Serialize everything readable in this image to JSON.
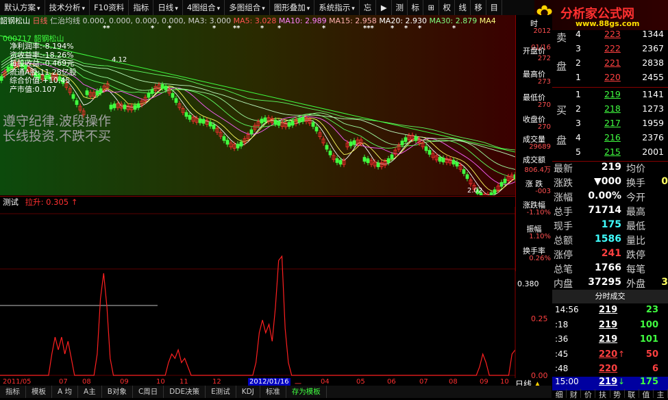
{
  "toolbar": [
    {
      "label": "默认方案",
      "arrow": "▾"
    },
    {
      "label": "技术分析",
      "arrow": "▾"
    },
    {
      "label": "F10资料",
      "arrow": ""
    },
    {
      "label": "指标",
      "arrow": ""
    },
    {
      "label": "日线",
      "arrow": "▾"
    },
    {
      "label": "4图组合",
      "arrow": "▾"
    },
    {
      "label": "多图组合",
      "arrow": "▾"
    },
    {
      "label": "图形叠加",
      "arrow": "▾"
    },
    {
      "label": "系统指示",
      "arrow": "▾"
    },
    {
      "label": "忘",
      "arrow": ""
    }
  ],
  "toolbar_icons": [
    "▶",
    "测",
    "标",
    "⊞",
    "权",
    "线",
    "移",
    "目"
  ],
  "logo": {
    "text": "分析家公式网",
    "url": "www.88gs.com"
  },
  "info_bar": {
    "name": "韶钢松山",
    "period": "日线",
    "ma_label": "仁治均线 0.000, 0.000, 0.000, 0.000,",
    "ma3": "MA3: 3.000",
    "ma5": "MA5: 3.028",
    "ma10": "MA10: 2.989",
    "ma15": "MA15: 2.958",
    "ma20": "MA20: 2.930",
    "ma30": "MA30: 2.879",
    "ma40": "MA4"
  },
  "stock_code": "000717 韶钢松山",
  "fundamentals": [
    "净利润率:-8.194%",
    "资收益率:-18.26%",
    "每股收益:-0.469元",
    "流通A股:11.28亿股",
    "综合价值:+10.45",
    "产市值:0.107"
  ],
  "watermark": [
    "遵守纪律.波段操作",
    "长线投资.不跌不买"
  ],
  "price_labels": {
    "high": "4.12",
    "low": "2.02"
  },
  "sub_chart": {
    "name": "测试",
    "indicator": "拉升: 0.305",
    "arrow": "↑",
    "yaxis": [
      "0.380",
      "0.25",
      "0.00"
    ]
  },
  "xaxis": [
    "2011/05",
    "07",
    "08",
    "09",
    "10",
    "11",
    "12",
    "2012/01/16",
    "一",
    "04",
    "05",
    "06",
    "07",
    "08",
    "09",
    "10"
  ],
  "bottom_tabs": [
    "指标",
    "模板",
    "A 均",
    "A主",
    "B对象",
    "C周日",
    "DDE决策",
    "E测试",
    "KDJ",
    "标准",
    "存为模板"
  ],
  "period_switch": "日线",
  "sidebar": [
    {
      "label": "时",
      "value": "2012"
    },
    {
      "label": "",
      "value": "01/16"
    },
    {
      "label": "开盘价",
      "value": "272"
    },
    {
      "label": "最高价",
      "value": "273"
    },
    {
      "label": "最低价",
      "value": "270"
    },
    {
      "label": "收盘价",
      "value": "270"
    },
    {
      "label": "成交量",
      "value": "29689"
    },
    {
      "label": "成交额",
      "value": "806.4万"
    },
    {
      "label": "涨 跌",
      "value": "-003"
    },
    {
      "label": "涨跌幅",
      "value": "-1.10%"
    },
    {
      "label": "振幅",
      "value": "1.10%"
    },
    {
      "label": "换手率",
      "value": "0.26%"
    }
  ],
  "orderbook": {
    "sell_label": [
      "卖",
      "盘"
    ],
    "buy_label": [
      "买",
      "盘"
    ],
    "sell": [
      {
        "level": "4",
        "price": "223",
        "vol": "1344"
      },
      {
        "level": "3",
        "price": "222",
        "vol": "2367"
      },
      {
        "level": "2",
        "price": "221",
        "vol": "2838"
      },
      {
        "level": "1",
        "price": "220",
        "vol": "2455"
      }
    ],
    "buy": [
      {
        "level": "1",
        "price": "219",
        "vol": "1141"
      },
      {
        "level": "2",
        "price": "218",
        "vol": "1273"
      },
      {
        "level": "3",
        "price": "217",
        "vol": "1959"
      },
      {
        "level": "4",
        "price": "216",
        "vol": "2376"
      },
      {
        "level": "5",
        "price": "215",
        "vol": "2001"
      }
    ]
  },
  "quote": [
    {
      "k1": "最新",
      "v1": "219",
      "k2": "均价",
      "v2": ""
    },
    {
      "k1": "涨跌",
      "v1": "▼000",
      "k2": "换手",
      "v2": "0"
    },
    {
      "k1": "涨幅",
      "v1": "0.00%",
      "k2": "今开",
      "v2": ""
    },
    {
      "k1": "总手",
      "v1": "71714",
      "k2": "最高",
      "v2": ""
    },
    {
      "k1": "现手",
      "v1": "175",
      "k2": "最低",
      "v2": ""
    },
    {
      "k1": "总额",
      "v1": "1586",
      "k2": "量比",
      "v2": ""
    },
    {
      "k1": "涨停",
      "v1": "241",
      "k2": "跌停",
      "v2": ""
    },
    {
      "k1": "总笔",
      "v1": "1766",
      "k2": "每笔",
      "v2": ""
    },
    {
      "k1": "内盘",
      "v1": "37295",
      "k2": "外盘",
      "v2": "3"
    }
  ],
  "ticks_header": "分时成交",
  "ticks": [
    {
      "time": "14:56",
      "price": "219",
      "arrow": "",
      "vol": "23"
    },
    {
      "time": ":18",
      "price": "219",
      "arrow": "",
      "vol": "100"
    },
    {
      "time": ":36",
      "price": "219",
      "arrow": "",
      "vol": "101"
    },
    {
      "time": ":45",
      "price": "220",
      "arrow": "↑",
      "vol": "50"
    },
    {
      "time": ":48",
      "price": "220",
      "arrow": "",
      "vol": "6"
    },
    {
      "time": "15:00",
      "price": "219",
      "arrow": "↓",
      "vol": "175"
    }
  ],
  "right_tabs": [
    "细",
    "财",
    "价",
    "扶",
    "势",
    "联",
    "值",
    "主"
  ],
  "chart_data": {
    "type": "line",
    "title": "测试 拉升",
    "x_range": [
      0,
      160
    ],
    "ylim": [
      0,
      0.38
    ],
    "series": [
      {
        "values": [
          0.0,
          0.0,
          0.0,
          0.0,
          0.0,
          0.0,
          0.0,
          0.0,
          0.0,
          0.0,
          0.0,
          0.0,
          0.0,
          0.0,
          0.0,
          0.0,
          0.05,
          0.09,
          0.06,
          0.09,
          0.05,
          0.08,
          0.04,
          0.0,
          0.0,
          0.0,
          0.0,
          0.0,
          0.0,
          0.0,
          0.05,
          0.18,
          0.24,
          0.16,
          0.04,
          0.0,
          0.0,
          0.0,
          0.0,
          0.0,
          0.0,
          0.0,
          0.0,
          0.0,
          0.0,
          0.0,
          0.0,
          0.0,
          0.0,
          0.0,
          0.0,
          0.0,
          0.03,
          0.05,
          0.04,
          0.06,
          0.03,
          0.04,
          0.02,
          0.0,
          0.0,
          0.0,
          0.0,
          0.0,
          0.0,
          0.0,
          0.0,
          0.0,
          0.0,
          0.0,
          0.0,
          0.0,
          0.0,
          0.0,
          0.0,
          0.0,
          0.0,
          0.0,
          0.0,
          0.03,
          0.1,
          0.13,
          0.1,
          0.12,
          0.08,
          0.16,
          0.27,
          0.28,
          0.11,
          0.03,
          0.0,
          0.0,
          0.0,
          0.0,
          0.0,
          0.0,
          0.0,
          0.0,
          0.0,
          0.0,
          0.0,
          0.0,
          0.0,
          0.0,
          0.0,
          0.0,
          0.0,
          0.0,
          0.0,
          0.0,
          0.0,
          0.0,
          0.0,
          0.0,
          0.0,
          0.0,
          0.0,
          0.0,
          0.0,
          0.0,
          0.0,
          0.0,
          0.0,
          0.0,
          0.0,
          0.0,
          0.0,
          0.0,
          0.0,
          0.0,
          0.0,
          0.0,
          0.0,
          0.0,
          0.0,
          0.0,
          0.0,
          0.0,
          0.0,
          0.0,
          0.0,
          0.0,
          0.0,
          0.0,
          0.0,
          0.0,
          0.0,
          0.0,
          0.02,
          0.05,
          0.03,
          0.0,
          0.0,
          0.0,
          0.0,
          0.0,
          0.0,
          0.0,
          0.05,
          0.06
        ]
      }
    ]
  }
}
